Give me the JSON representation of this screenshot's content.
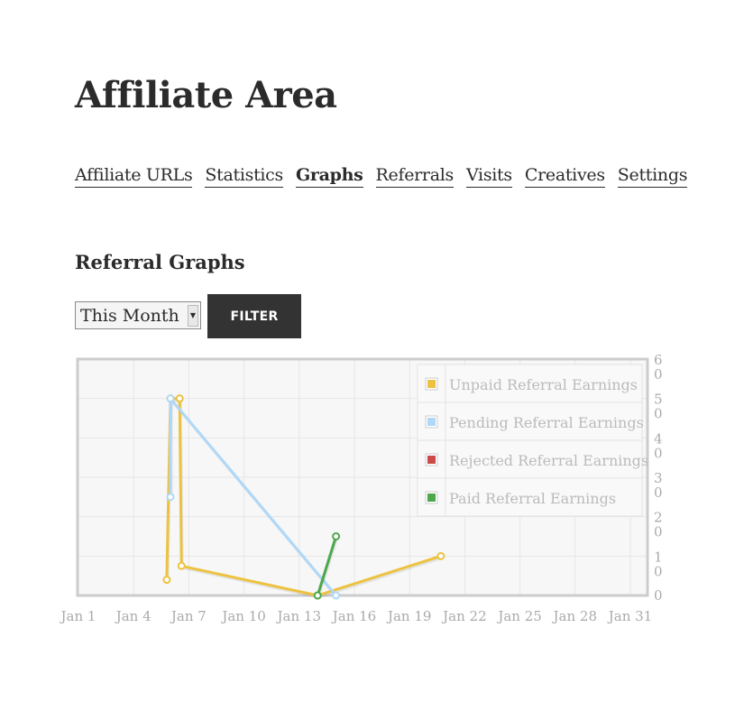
{
  "page": {
    "title": "Affiliate Area"
  },
  "tabs": [
    {
      "label": "Affiliate URLs",
      "active": false
    },
    {
      "label": "Statistics",
      "active": false
    },
    {
      "label": "Graphs",
      "active": true
    },
    {
      "label": "Referrals",
      "active": false
    },
    {
      "label": "Visits",
      "active": false
    },
    {
      "label": "Creatives",
      "active": false
    },
    {
      "label": "Settings",
      "active": false
    }
  ],
  "section": {
    "title": "Referral Graphs"
  },
  "filter": {
    "selected": "This Month",
    "button_label": "FILTER"
  },
  "chart_data": {
    "type": "line",
    "title": "",
    "xlabel": "",
    "ylabel": "",
    "x_unit": "day of January",
    "xlim": [
      1,
      32
    ],
    "ylim": [
      0,
      60
    ],
    "x_ticks": [
      1,
      4,
      7,
      10,
      13,
      16,
      19,
      22,
      25,
      28,
      31
    ],
    "x_tick_labels": [
      "Jan 1",
      "Jan 4",
      "Jan 7",
      "Jan 10",
      "Jan 13",
      "Jan 16",
      "Jan 19",
      "Jan 22",
      "Jan 25",
      "Jan 28",
      "Jan 31"
    ],
    "y_ticks": [
      0,
      10,
      20,
      30,
      40,
      50,
      60
    ],
    "y_tick_labels": [
      "0",
      "10",
      "20",
      "30",
      "40",
      "50",
      "60"
    ],
    "y_axis_side": "right",
    "grid": true,
    "legend_position": "top-right",
    "series": [
      {
        "name": "Unpaid Referral Earnings",
        "color": "#edc240",
        "points": [
          [
            5.8,
            4
          ],
          [
            6.0,
            50
          ],
          [
            6.5,
            50
          ],
          [
            6.6,
            7.5
          ],
          [
            14.0,
            0
          ],
          [
            20.7,
            10
          ]
        ]
      },
      {
        "name": "Pending Referral Earnings",
        "color": "#afd8f8",
        "points": [
          [
            6.0,
            25
          ],
          [
            6.0,
            50
          ],
          [
            15.0,
            0
          ]
        ]
      },
      {
        "name": "Rejected Referral Earnings",
        "color": "#cb4b4b",
        "points": []
      },
      {
        "name": "Paid Referral Earnings",
        "color": "#4da74d",
        "points": [
          [
            14.0,
            0
          ],
          [
            15.0,
            15
          ]
        ]
      }
    ]
  }
}
